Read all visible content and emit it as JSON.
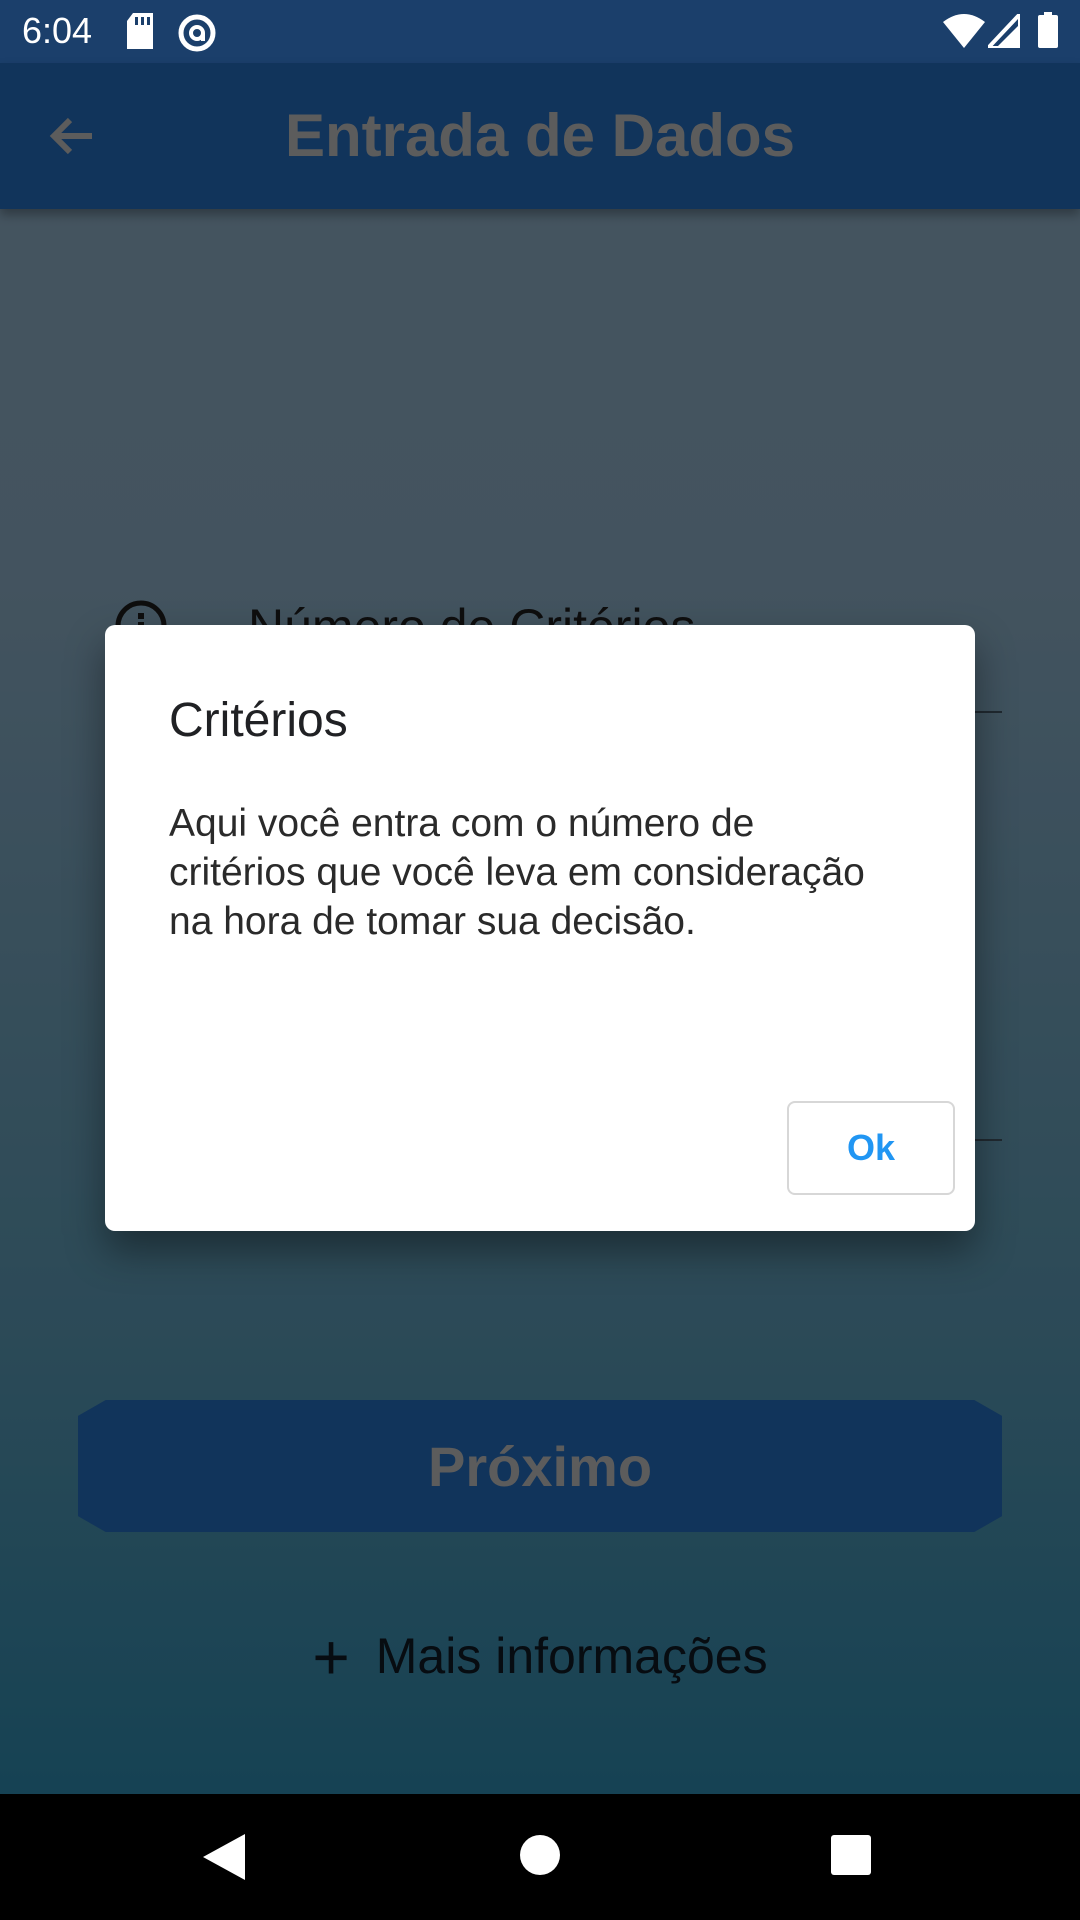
{
  "status_bar": {
    "time": "6:04",
    "icons": [
      "sd-card-icon",
      "at-sign-icon",
      "wifi-icon",
      "signal-icon",
      "battery-icon"
    ]
  },
  "app_bar": {
    "title": "Entrada de Dados",
    "back_icon": "arrow-back-icon"
  },
  "form": {
    "field_label": "Número de Critérios",
    "next_button": "Próximo",
    "more_info": "Mais informações"
  },
  "dialog": {
    "title": "Critérios",
    "body": "Aqui você entra com o número de critérios que você leva em consideração na hora de tomar sua decisão.",
    "ok_button": "Ok"
  },
  "nav_bar": {
    "icons": [
      "back-triangle-icon",
      "home-circle-icon",
      "recents-square-icon"
    ]
  },
  "colors": {
    "status_bar": "#1b3f6b",
    "app_bar": "#1f5fa6",
    "accent": "#2196f3"
  }
}
